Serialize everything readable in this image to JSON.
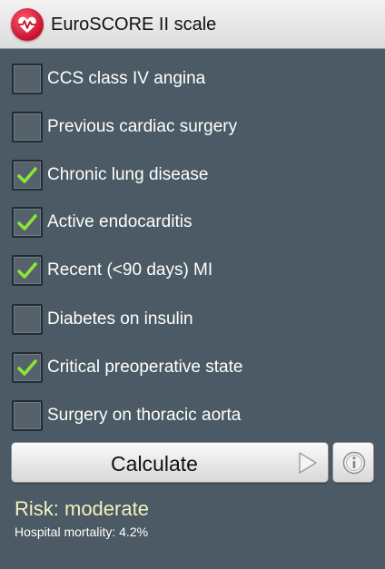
{
  "app": {
    "title": "EuroSCORE II scale",
    "icon": "heart-pulse-icon",
    "accent_color": "#c8102e"
  },
  "items": [
    {
      "label": "CCS class IV angina",
      "checked": false
    },
    {
      "label": "Previous cardiac surgery",
      "checked": false
    },
    {
      "label": "Chronic lung disease",
      "checked": true
    },
    {
      "label": "Active endocarditis",
      "checked": true
    },
    {
      "label": "Recent (<90 days) MI",
      "checked": true
    },
    {
      "label": "Diabetes on insulin",
      "checked": false
    },
    {
      "label": "Critical preoperative state",
      "checked": true
    },
    {
      "label": "Surgery on thoracic aorta",
      "checked": false
    }
  ],
  "check_color": "#8ee23c",
  "actions": {
    "calculate_label": "Calculate",
    "calculate_icon": "play-triangle-icon",
    "info_icon": "info-icon"
  },
  "result": {
    "risk": "Risk: moderate",
    "mortality": "Hospital mortality: 4.2%"
  }
}
